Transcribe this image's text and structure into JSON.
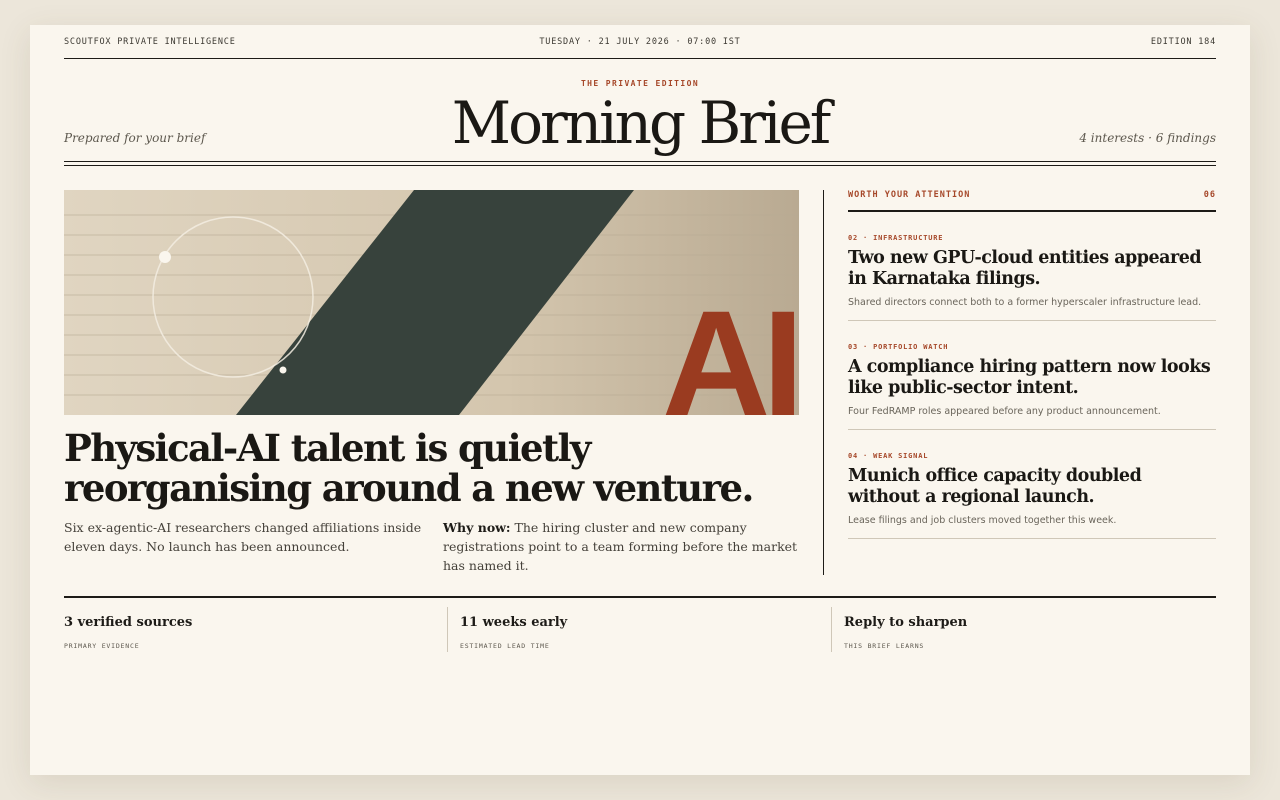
{
  "masthead": {
    "publisher": "SCOUTFOX PRIVATE INTELLIGENCE",
    "dateline": "TUESDAY · 21 JULY 2026 · 07:00 IST",
    "edition": "EDITION 184",
    "kicker": "THE PRIVATE EDITION",
    "title": "Morning Brief",
    "prepared": "Prepared for your brief",
    "summary": "4 interests · 6 findings"
  },
  "lead": {
    "hero_text": "AI",
    "headline": "Physical-AI talent is quietly reorganising around a new venture.",
    "deck": "Six ex-agentic-AI researchers changed affiliations inside eleven days. No launch has been announced.",
    "why_label": "Why now:",
    "why_text": "The hiring cluster and new company registrations point to a team forming before the market has named it."
  },
  "sidebar": {
    "heading": "WORTH YOUR ATTENTION",
    "count": "06",
    "items": [
      {
        "tag": "02 · INFRASTRUCTURE",
        "title": "Two new GPU-cloud entities appeared in Karnataka filings.",
        "summary": "Shared directors connect both to a former hyperscaler infrastructure lead."
      },
      {
        "tag": "03 · PORTFOLIO WATCH",
        "title": "A compliance hiring pattern now looks like public-sector intent.",
        "summary": "Four FedRAMP roles appeared before any product announcement."
      },
      {
        "tag": "04 · WEAK SIGNAL",
        "title": "Munich office capacity doubled without a regional launch.",
        "summary": "Lease filings and job clusters moved together this week."
      }
    ]
  },
  "footer": {
    "stats": [
      {
        "value": "3 verified sources",
        "label": "PRIMARY EVIDENCE"
      },
      {
        "value": "11 weeks early",
        "label": "ESTIMATED LEAD TIME"
      },
      {
        "value": "Reply to sharpen",
        "label": "THIS BRIEF LEARNS"
      }
    ]
  },
  "colors": {
    "accent": "#a6482a",
    "paper": "#faf6ee",
    "ink": "#1d1b17",
    "hero_band": "#37423c"
  }
}
